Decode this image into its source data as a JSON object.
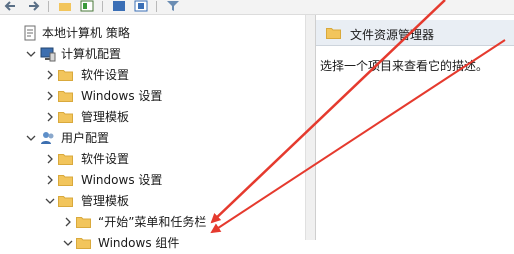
{
  "toolbar": {
    "icons": [
      "back-icon",
      "forward-icon",
      "up-folder-icon",
      "show-hide-tree-icon",
      "help-icon",
      "properties-icon",
      "filter-icon"
    ]
  },
  "tree": {
    "root": "本地计算机 策略",
    "computer_config": "计算机配置",
    "computer_children": [
      "软件设置",
      "Windows 设置",
      "管理模板"
    ],
    "user_config": "用户配置",
    "user_children": [
      "软件设置",
      "Windows 设置",
      "管理模板"
    ],
    "admin_children": [
      "“开始”菜单和任务栏",
      "Windows 组件"
    ]
  },
  "content": {
    "header": "文件资源管理器",
    "description": "选择一个项目来查看它的描述。"
  },
  "colors": {
    "folder": "#f2c55c",
    "folder_dark": "#d9a93c",
    "arrow": "#e53a2e",
    "header_bg": "#e9eef4"
  }
}
